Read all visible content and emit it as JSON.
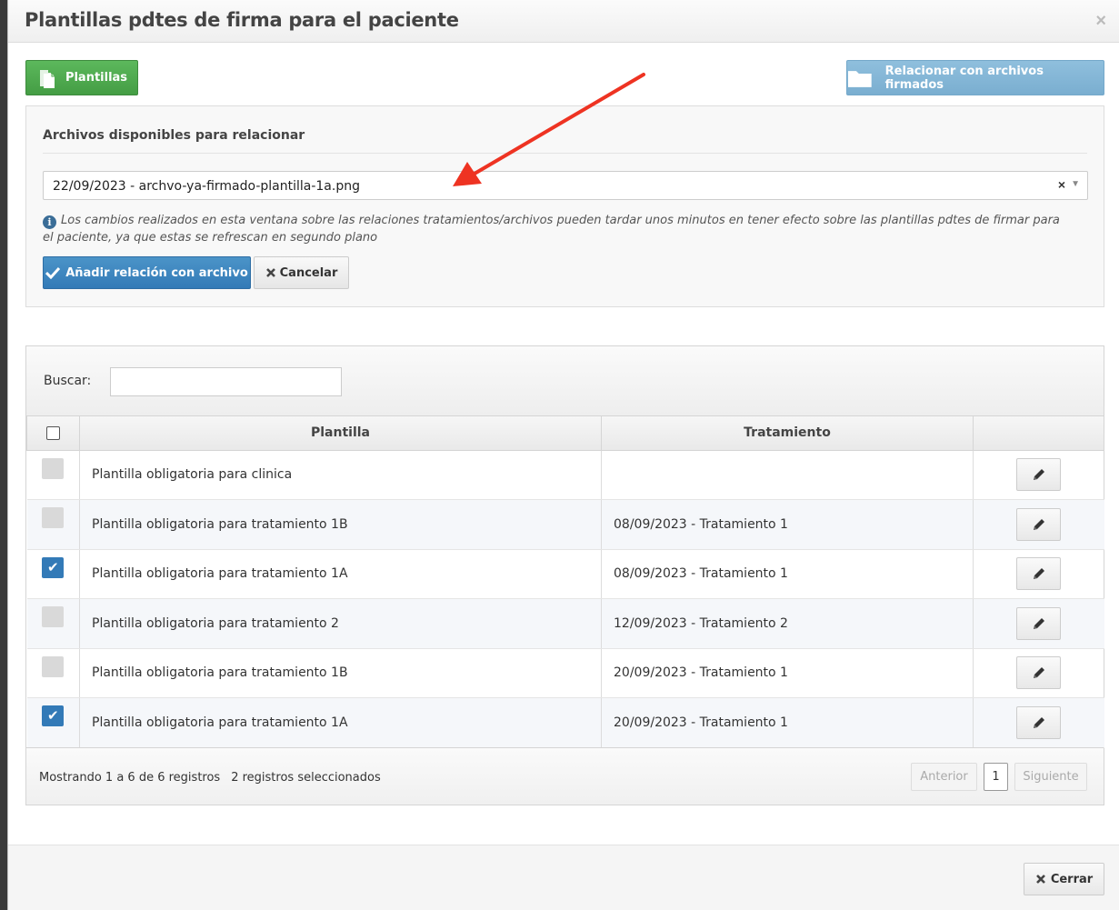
{
  "modal": {
    "title": "Plantillas pdtes de firma para el paciente",
    "close_glyph": "×"
  },
  "toolbar": {
    "plantillas_label": "Plantillas",
    "relacionar_label": "Relacionar con archivos firmados"
  },
  "panel": {
    "title": "Archivos disponibles para relacionar",
    "selected_file": "22/09/2023 - archvo-ya-firmado-plantilla-1a.png",
    "note": "Los cambios realizados en esta ventana sobre las relaciones tratamientos/archivos pueden tardar unos minutos en tener efecto sobre las plantillas pdtes de firmar para el paciente, ya que estas se refrescan en segundo plano",
    "add_label": "Añadir relación con archivo",
    "cancel_label": "Cancelar"
  },
  "search": {
    "label": "Buscar:",
    "value": "",
    "placeholder": ""
  },
  "table": {
    "headers": [
      "",
      "Plantilla",
      "Tratamiento",
      ""
    ],
    "rows": [
      {
        "checked": false,
        "plantilla": "Plantilla obligatoria para clinica",
        "tratamiento": ""
      },
      {
        "checked": false,
        "plantilla": "Plantilla obligatoria para tratamiento 1B",
        "tratamiento": "08/09/2023 - Tratamiento 1"
      },
      {
        "checked": true,
        "plantilla": "Plantilla obligatoria para tratamiento 1A",
        "tratamiento": "08/09/2023 - Tratamiento 1"
      },
      {
        "checked": false,
        "plantilla": "Plantilla obligatoria para tratamiento 2",
        "tratamiento": "12/09/2023 - Tratamiento 2"
      },
      {
        "checked": false,
        "plantilla": "Plantilla obligatoria para tratamiento 1B",
        "tratamiento": "20/09/2023 - Tratamiento 1"
      },
      {
        "checked": true,
        "plantilla": "Plantilla obligatoria para tratamiento 1A",
        "tratamiento": "20/09/2023 - Tratamiento 1"
      }
    ]
  },
  "footer": {
    "info": "Mostrando 1 a 6 de 6 registros",
    "selected": "2 registros seleccionados",
    "prev_label": "Anterior",
    "current_page": "1",
    "next_label": "Siguiente"
  },
  "modal_footer": {
    "close_label": "Cerrar"
  },
  "colors": {
    "green": "#5cb85c",
    "primary": "#337ab7",
    "light_blue": "#7aaed0",
    "annotation_arrow": "#ee3322"
  }
}
